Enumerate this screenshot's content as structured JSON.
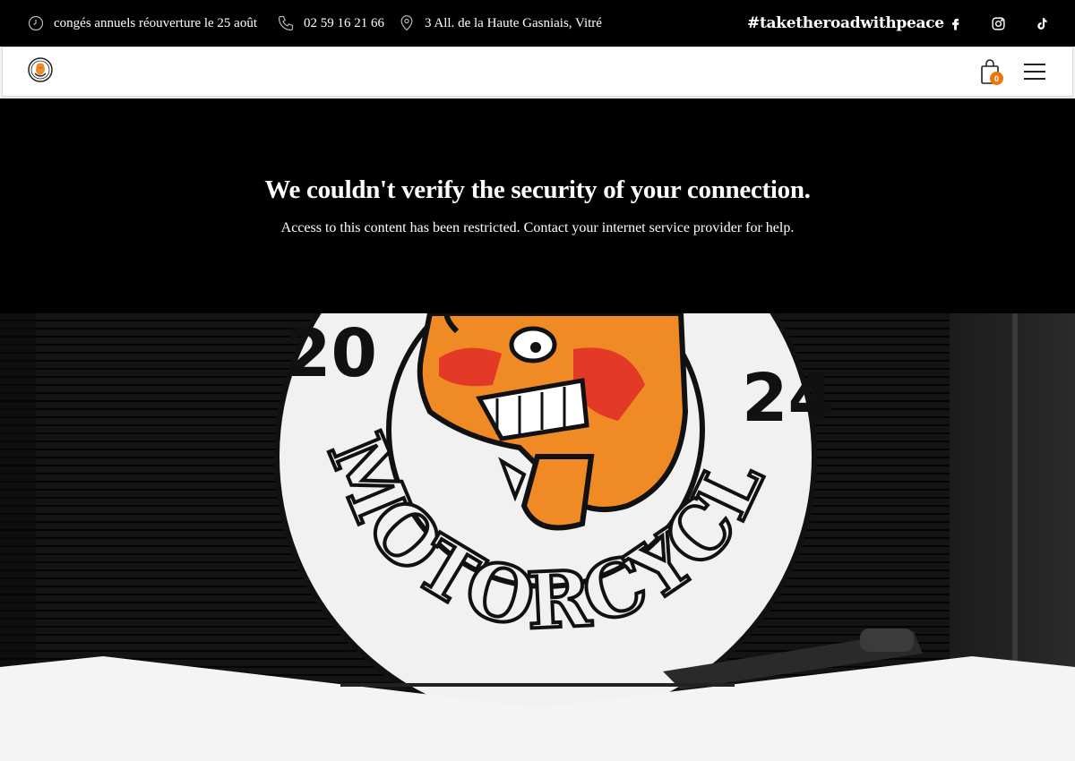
{
  "topbar": {
    "hours": "congés annuels réouverture le 25 août",
    "phone": "02 59 16 21 66",
    "address": "3 All. de la Haute Gasniais, Vitré",
    "hashtag": "#taketheroadwithpeace",
    "icons": [
      "clock-icon",
      "phone-icon",
      "location-pin-icon",
      "facebook-icon",
      "instagram-icon",
      "tiktok-icon"
    ]
  },
  "nav": {
    "cart_count": "0",
    "icons": [
      "shopping-bag-icon",
      "hamburger-menu-icon"
    ]
  },
  "notice": {
    "title": "We couldn't verify the security of your connection.",
    "message": "Access to this content has been restricted. Contact your internet service provider for help."
  },
  "hero": {
    "logo_year_left": "20",
    "logo_year_right": "24",
    "logo_word": "MOTORCYCLE",
    "colors": {
      "accent": "#f08a24",
      "red": "#e23a26",
      "bg": "#0c0c0c"
    }
  }
}
